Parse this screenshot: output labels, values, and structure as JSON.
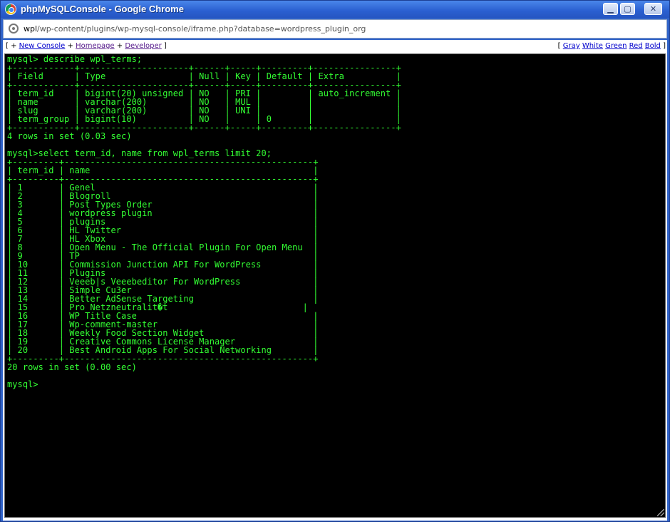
{
  "window": {
    "title": "phpMySQLConsole - Google Chrome",
    "min_glyph": "▁",
    "max_glyph": "▢",
    "close_glyph": "✕"
  },
  "address": {
    "host": "wpl",
    "path": "/wp-content/plugins/wp-mysql-console/iframe.php?database=wordpress_plugin_org"
  },
  "toolbar": {
    "left_open": "[ + ",
    "new_console": "New Console",
    "sep1": " + ",
    "homepage": "Homepage",
    "sep2": " + ",
    "developer": "Developer",
    "left_close": " ]",
    "right_open": "[ ",
    "gray": "Gray",
    "white": "White",
    "green": "Green",
    "red": "Red",
    "bold": "Bold",
    "right_close": " ]"
  },
  "terminal": {
    "lines": [
      "mysql> describe wpl_terms;",
      "+------------+---------------------+------+-----+---------+----------------+",
      "| Field      | Type                | Null | Key | Default | Extra          |",
      "+------------+---------------------+------+-----+---------+----------------+",
      "| term_id    | bigint(20) unsigned | NO   | PRI |         | auto_increment |",
      "| name       | varchar(200)        | NO   | MUL |         |                |",
      "| slug       | varchar(200)        | NO   | UNI |         |                |",
      "| term_group | bigint(10)          | NO   |     | 0       |                |",
      "+------------+---------------------+------+-----+---------+----------------+",
      "4 rows in set (0.03 sec)",
      "",
      "mysql>select term_id, name from wpl_terms limit 20;",
      "+---------+------------------------------------------------+",
      "| term_id | name                                           |",
      "+---------+------------------------------------------------+",
      "| 1       | Genel                                          |",
      "| 2       | Blogroll                                       |",
      "| 3       | Post Types Order                               |",
      "| 4       | wordpress plugin                               |",
      "| 5       | plugins                                        |",
      "| 6       | HL Twitter                                     |",
      "| 7       | HL Xbox                                        |",
      "| 8       | Open Menu - The Official Plugin For Open Menu  |",
      "| 9       | TP                                             |",
      "| 10      | Commission Junction API For WordPress          |",
      "| 11      | Plugins                                        |",
      "| 12      | Veeeb|s Veeebeditor For WordPress              |",
      "| 13      | Simple Cu3er                                   |",
      "| 14      | Better AdSense Targeting                       |",
      "| 15      | Pro Netzneutralit�t                          |",
      "| 16      | WP Title Case                                  |",
      "| 17      | Wp-comment-master                              |",
      "| 18      | Weekly Food Section Widget                     |",
      "| 19      | Creative Commons License Manager               |",
      "| 20      | Best Android Apps For Social Networking        |",
      "+---------+------------------------------------------------+",
      "20 rows in set (0.00 sec)",
      "",
      "mysql>"
    ]
  }
}
